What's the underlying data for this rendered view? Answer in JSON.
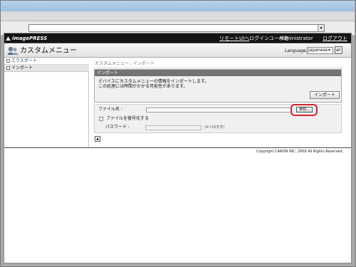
{
  "header": {
    "logo_text": "imagePRESS",
    "remote_ui_link": "リモートUIへ",
    "login_user_label": "ログインユーザ名",
    "login_user_name": "Administrator",
    "logout_link": "ログアウト"
  },
  "title_bar": {
    "page_title": "カスタムメニュー",
    "language_label": "Language:",
    "language_value": "Japanese"
  },
  "sidebar": {
    "items": [
      {
        "label": "エクスポート",
        "selected": false
      },
      {
        "label": "インポート",
        "selected": true
      }
    ]
  },
  "main": {
    "breadcrumb": "カスタムメニュー : インポート",
    "import_panel": {
      "title": "インポート",
      "description_line1": "デバイスにカスタムメニューの情報をインポートします。",
      "description_line2": "この処理には時間がかかる可能性があります。",
      "import_button": "インポート"
    },
    "form": {
      "file_name_label": "ファイル名 :",
      "browse_button": "参照...",
      "decrypt_checkbox_label": "ファイルを復号化する",
      "decrypt_checked": false,
      "password_label": "パスワード :",
      "password_hint": "(4〜16文字)"
    }
  },
  "footer": {
    "copyright": "Copyright CANON INC. 2009 All Rights Reserved."
  },
  "colors": {
    "top_header": "#141414",
    "panel_header": "#737373",
    "highlight": "#d3262e"
  }
}
